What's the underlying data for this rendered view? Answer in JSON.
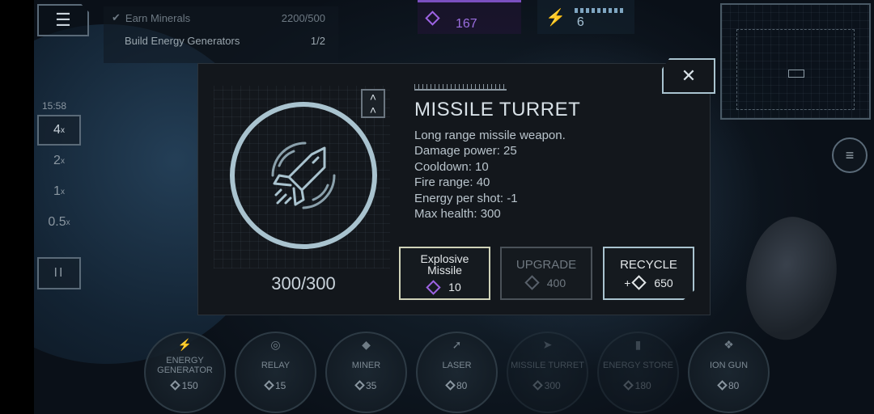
{
  "hud": {
    "menu_icon": "hamburger-icon",
    "objectives": [
      {
        "label": "Earn Minerals",
        "progress": "2200/500",
        "done": true
      },
      {
        "label": "Build Energy Generators",
        "progress": "1/2",
        "done": false
      }
    ],
    "minerals": "167",
    "energy": "6",
    "clock": "15:58",
    "speeds": [
      {
        "value": "4",
        "active": true
      },
      {
        "value": "2",
        "active": false
      },
      {
        "value": "1",
        "active": false
      },
      {
        "value": "0.5",
        "active": false
      }
    ],
    "speed_suffix": "x",
    "pause_icon": "pause-icon"
  },
  "modal": {
    "title": "MISSILE TURRET",
    "description": [
      "Long range missile weapon.",
      "Damage power: 25",
      "Cooldown: 10",
      "Fire range: 40",
      "Energy per shot: -1",
      "Max health: 300"
    ],
    "health": "300/300",
    "actions": {
      "explosive": {
        "label": "Explosive Missile",
        "cost": "10"
      },
      "upgrade": {
        "label": "UPGRADE",
        "cost": "400"
      },
      "recycle": {
        "label": "RECYCLE",
        "prefix": "+",
        "cost": "650"
      }
    },
    "close_icon": "close-icon",
    "upgrade_icon": "double-chevron-up-icon",
    "unit_icon": "rocket-icon"
  },
  "build_bar": [
    {
      "name": "ENERGY GENERATOR",
      "cost": "150",
      "icon": "lightning-icon",
      "enabled": true
    },
    {
      "name": "RELAY",
      "cost": "15",
      "icon": "relay-icon",
      "enabled": true
    },
    {
      "name": "MINER",
      "cost": "35",
      "icon": "crystal-icon",
      "enabled": true
    },
    {
      "name": "LASER",
      "cost": "80",
      "icon": "laser-icon",
      "enabled": true
    },
    {
      "name": "MISSILE TURRET",
      "cost": "300",
      "icon": "rocket-icon",
      "enabled": false
    },
    {
      "name": "ENERGY STORE",
      "cost": "180",
      "icon": "battery-icon",
      "enabled": false
    },
    {
      "name": "ION GUN",
      "cost": "80",
      "icon": "ion-gun-icon",
      "enabled": true
    }
  ],
  "colors": {
    "mineral_purple": "#9d63e3",
    "accent_cyan": "#a9c3cf",
    "modal_bg": "#13171c"
  }
}
